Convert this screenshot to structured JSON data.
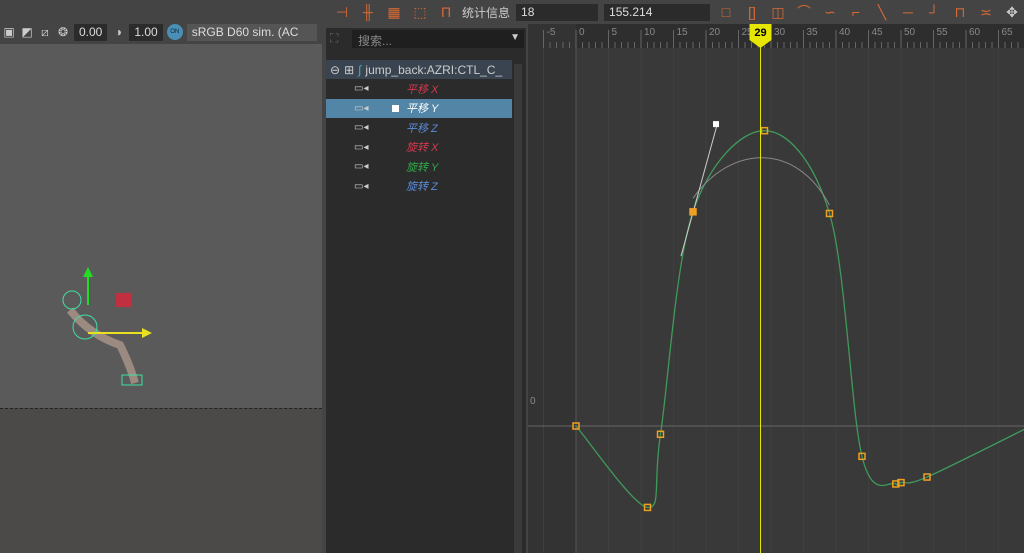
{
  "viewport": {
    "exposure": "0.00",
    "gamma": "1.00",
    "colorspace_badge": "ON",
    "colorspace": "sRGB D60 sim. (AC"
  },
  "toolbar": {
    "stats_label": "统计信息",
    "frame_value": "18",
    "key_value": "155.214"
  },
  "outliner": {
    "search_placeholder": "搜索...",
    "node": "jump_back:AZRI:CTL_C_",
    "channels": [
      {
        "label": "平移 X",
        "color": "#d2384f",
        "selected": false
      },
      {
        "label": "平移 Y",
        "color": "#ffffff",
        "selected": true
      },
      {
        "label": "平移 Z",
        "color": "#5b8bd6",
        "selected": false
      },
      {
        "label": "旋转 X",
        "color": "#d2384f",
        "selected": false
      },
      {
        "label": "旋转 Y",
        "color": "#2fa84b",
        "selected": false
      },
      {
        "label": "旋转 Z",
        "color": "#5b8bd6",
        "selected": false
      }
    ]
  },
  "graph": {
    "current_frame": "29",
    "zero_label": "0",
    "ruler_labels": [
      "-5",
      "0",
      "5",
      "10",
      "15",
      "20",
      "25",
      "30",
      "35",
      "40",
      "45",
      "50",
      "55",
      "60",
      "65"
    ],
    "keys": [
      [
        0,
        0
      ],
      [
        11,
        -59
      ],
      [
        13,
        -6
      ],
      [
        18,
        155.214
      ],
      [
        29,
        214
      ],
      [
        39,
        154
      ],
      [
        44,
        -22
      ],
      [
        49.2,
        -42
      ],
      [
        50,
        -41
      ],
      [
        54,
        -37
      ],
      [
        70,
        0
      ]
    ],
    "colors": {
      "curve": "#3f9a5a",
      "key": "#f0a020",
      "cursor": "#e6e600"
    }
  }
}
